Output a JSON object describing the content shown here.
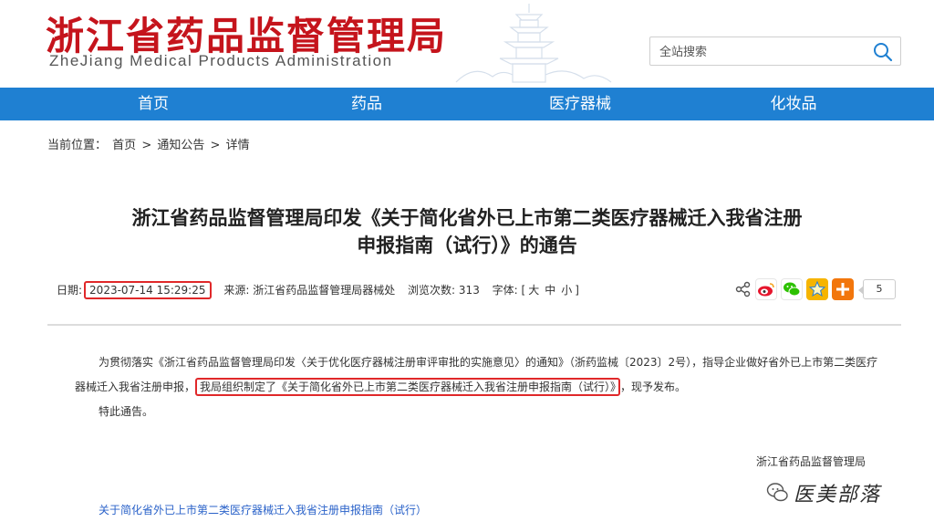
{
  "header": {
    "logo_cn": "浙江省药品监督管理局",
    "logo_en": "ZheJiang Medical Products Administration",
    "search_placeholder": "全站搜索"
  },
  "nav": {
    "items": [
      "首页",
      "药品",
      "医疗器械",
      "化妆品"
    ]
  },
  "breadcrumb": {
    "prefix": "当前位置：",
    "items": [
      "首页",
      "通知公告",
      "详情"
    ],
    "separator": ">"
  },
  "article": {
    "title_line1": "浙江省药品监督管理局印发《关于简化省外已上市第二类医疗器械迁入我省注册",
    "title_line2": "申报指南（试行）》的通告",
    "meta": {
      "date_label": "日期:",
      "date_value": "2023-07-14 15:29:25",
      "source_label": "来源:",
      "source_value": "浙江省药品监督管理局器械处",
      "views_label": "浏览次数:",
      "views_value": "313",
      "font_label": "字体:",
      "font_open": "[",
      "font_large": "大",
      "font_medium": "中",
      "font_small": "小",
      "font_close": "]"
    },
    "share_count": "5",
    "body_p1_a": "为贯彻落实《浙江省药品监督管理局印发〈关于优化医疗器械注册审评审批的实施意见〉的通知》（浙药监械〔2023〕2号），指导企业做好省外已上市第二类医疗器械迁入我省注册申报，",
    "body_p1_hl": "我局组织制定了《关于简化省外已上市第二类医疗器械迁入我省注册申报指南（试行）》",
    "body_p1_b": "，现予发布。",
    "body_p2": "特此通告。",
    "signature": "浙江省药品监督管理局",
    "attachment": "关于简化省外已上市第二类医疗器械迁入我省注册申报指南（试行）"
  },
  "watermark": {
    "text": "医美部落"
  },
  "colors": {
    "brand_red": "#c5141c",
    "nav_blue": "#1f80d2",
    "highlight_red": "#e0282a",
    "link_blue": "#2a62c9"
  }
}
